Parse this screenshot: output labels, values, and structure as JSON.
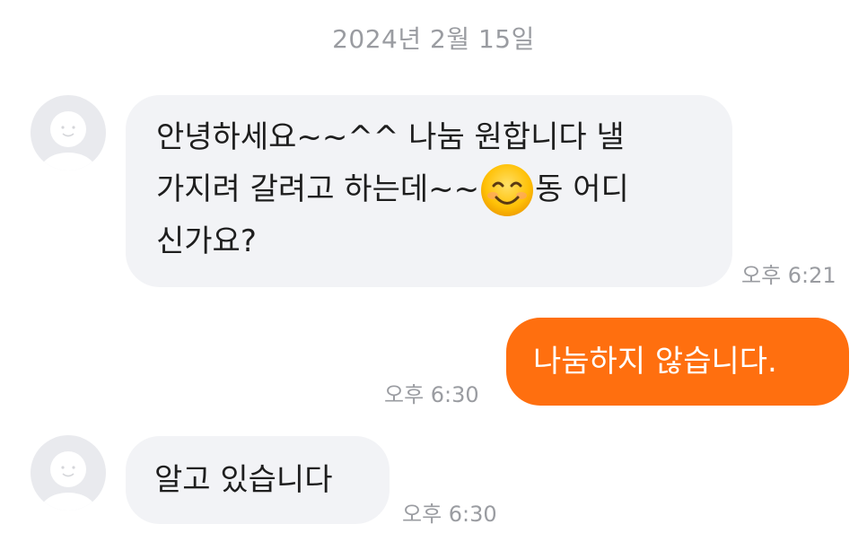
{
  "chat": {
    "date_divider": "2024년 2월 15일",
    "messages": [
      {
        "sender": "other",
        "lines": [
          "안녕하세요~~^^ 나눔 원합니다 낼",
          "가지려 갈려고 하는데~~",
          "동 어디",
          "신가요?"
        ],
        "emoji": "smiling-face-icon",
        "time": "오후 6:21"
      },
      {
        "sender": "me",
        "text": "나눔하지 않습니다.",
        "time": "오후 6:30"
      },
      {
        "sender": "other",
        "text": "알고 있습니다",
        "time": "오후 6:30"
      }
    ]
  },
  "colors": {
    "outgoing_bubble": "#ff6f0f",
    "incoming_bubble": "#f2f3f6",
    "timestamp": "#9a9ca1"
  }
}
